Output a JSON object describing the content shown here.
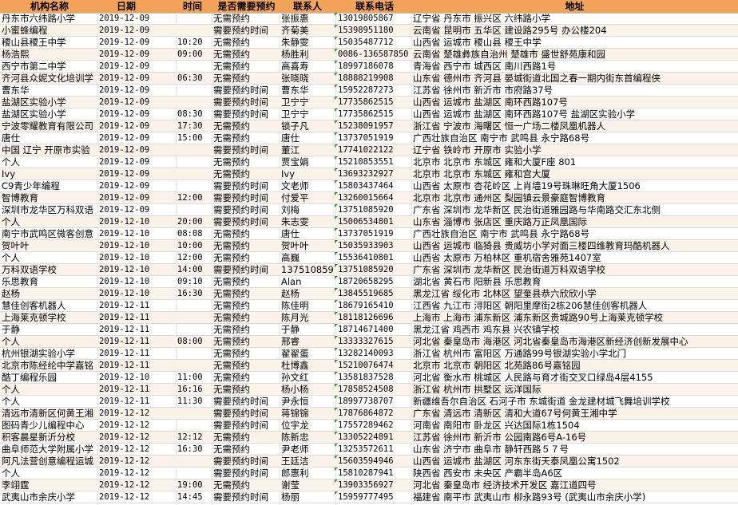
{
  "headers": [
    "机构名称",
    "日期",
    "时间",
    "是否需要预约",
    "联系人",
    "联系电话",
    "地址"
  ],
  "rows": [
    [
      "丹东市六纬路小学",
      "2019-12-09",
      "",
      "无需预约",
      "张振惠",
      "13019805867",
      "辽宁省 丹东市 振兴区 六纬路小学"
    ],
    [
      "小蜜蜂编程",
      "2019-12-09",
      "",
      "需要预约时间",
      "齐菊美",
      "15398951180",
      "云南省 昆明市 五华区 建设路295号 办公楼204"
    ],
    [
      "稷山县稷王中学",
      "2019-12-09",
      "10:20",
      "无需预约",
      "朱静雯",
      "15035487712",
      "山西省 运城市 稷山县 稷王中学"
    ],
    [
      "杨浩熙",
      "2019-12-09",
      "09:00",
      "无需预约",
      "杨胜利",
      "0086-136587850",
      "云南省 楚雄彝族自治州 楚雄市 盛世舒苑康和园"
    ],
    [
      "西宁市第二中学",
      "2019-12-09",
      "",
      "无需预约",
      "高喜寿",
      "18997186078",
      "青海省 西宁市 城西区 南川西路1号"
    ],
    [
      "齐河县众妮文化培训学",
      "2019-12-09",
      "06:30",
      "无需预约",
      "张晓晓",
      "18888219908",
      "山东省 德州市 齐河县 晏城街道北国之春一期内街东首编程侠"
    ],
    [
      "曹东华",
      "2019-12-09",
      "",
      "需要预约时间",
      "曹东华",
      "15952287273",
      "江苏省 徐州市 新沂市 市府路37号"
    ],
    [
      "盐湖区实验小学",
      "2019-12-09",
      "",
      "需要预约时间",
      "卫宁宁",
      "17735862515",
      "山西省 运城市 盐湖区 南环西路107号"
    ],
    [
      "盐湖区实验小学",
      "2019-12-09",
      "08:30",
      "需要预约时间",
      "卫宁宁",
      "17735862515",
      "山西省 运城市 盐湖区 南环西路107号 盐湖区实验小学"
    ],
    [
      "宁波零耀教育有限公司",
      "2019-12-09",
      "17:30",
      "无需预约",
      "锁子凡",
      "15238091957",
      "浙江省 宁波市 海曙区 恒一广场二楼凤凰机器人"
    ],
    [
      "唐仕",
      "2019-12-09",
      "15:00",
      "无需预约",
      "唐仕",
      "13737051919",
      "广西壮族自治区 南宁市 武鸣县 永宁路68号"
    ],
    [
      "中国 辽宁 开原市实验",
      "2019-12-09",
      "",
      "需要预约时间",
      "董江",
      "17741022122",
      "辽宁省 铁岭市 开原市 实验小学"
    ],
    [
      "个人",
      "2019-12-09",
      "",
      "无需预约",
      "贾宝娟",
      "15210853551",
      "北京市 北京市 东城区 雍和大厦F座 801"
    ],
    [
      "Ivy",
      "2019-12-09",
      "",
      "无需预约",
      "Ivy",
      "13693232927",
      "北京市 北京市 东城区 雍和宫大厦"
    ],
    [
      "C9青少年编程",
      "2019-12-09",
      "",
      "需要预约时间",
      "文老师",
      "15803437464",
      "山西省 太原市 杏花岭区 上肖墙19号珠琳旺角大厦1506"
    ],
    [
      "智博教育",
      "2019-12-09",
      "12:00",
      "需要预约时间",
      "付爱平",
      "13260015664",
      "北京市 北京市 通州区 梨园镇云景豪庭智博教育"
    ],
    [
      "深圳市龙华区万科双语",
      "2019-12-09",
      "",
      "需要预约时间",
      "刘梅",
      "13751085920",
      "广东省 深圳市 龙华新区 民治街道雅园路与华南路交汇东北侧"
    ],
    [
      "个人",
      "2019-12-10",
      "20:00",
      "需要预约时间",
      "朱志雯",
      "15006534801",
      "山东省 淄博市 张店区 重庆路万正凤凰国际"
    ],
    [
      "南宁市武鸣区微客创意",
      "2019-12-10",
      "08:08",
      "无需预约",
      "唐仕",
      "13737051919",
      "广西壮族自治区 南宁市 武鸣县 永宁路68号"
    ],
    [
      "贺叶叶",
      "2019-12-10",
      "10:00",
      "无需预约",
      "贺叶叶",
      "15035933903",
      "山西省 运城市 临猗县 贵威坊小学对面三楼四维教育玛酷机器人"
    ],
    [
      "个人",
      "2019-12-10",
      "12:00",
      "无需预约",
      "高巍",
      "15536410801",
      "山西省 太原市 万柏林区 重机宿舍雅苑1407室"
    ],
    [
      "万科双语学校",
      "2019-12-10",
      "14:00",
      "需要预约时间",
      "13751085920",
      "13751085920",
      "广东省 深圳市 龙华新区 民治街道万科双语学校"
    ],
    [
      "乐思教育",
      "2019-12-10",
      "09:10",
      "无需预约",
      "Alan",
      "18720658295",
      "湖北省 黄石市 阳新县 乐思教育"
    ],
    [
      "赵杨",
      "2019-12-10",
      "16:30",
      "无需预约",
      "赵杨",
      "13845519685",
      "黑龙江省 绥化市 北林区 望奎县恭六欣欣小学"
    ],
    [
      "慧佳创客机器人",
      "2019-12-11",
      "",
      "无需预约",
      "陈佳明",
      "18679165410",
      "江西省 九江市 浔阳区 朝阳里摩街2栋206慧佳创客机器人"
    ],
    [
      "上海莱克顿学校",
      "2019-12-11",
      "",
      "无需预约",
      "陈月光",
      "18118126696",
      "上海市 上海市 浦东新区 浦东新区贵城路90号上海莱克顿学校"
    ],
    [
      "于静",
      "2019-12-11",
      "",
      "无需预约",
      "于静",
      "18714671400",
      "黑龙江省 鸡西市 鸡东县 兴农镇学校"
    ],
    [
      "个人",
      "2019-12-11",
      "08:00",
      "无需预约",
      "邢睿",
      "13333327615",
      "河北省 秦皇岛市 海港区 河北省秦皇岛市海港区新经济创新发展中心"
    ],
    [
      "杭州银湖实验小学",
      "2019-12-11",
      "",
      "无需预约",
      "翟翟蛋",
      "13282140093",
      "浙江省 杭州市 富阳区 万通路99号银湖实验小学北门"
    ],
    [
      "北京市陈经纶中学嘉铭",
      "2019-12-11",
      "",
      "无需预约",
      "杜博鑫",
      "15210076474",
      "北京市 北京市 朝阳区 北苑路86号嘉铭园"
    ],
    [
      "酷丁编程乐园",
      "2019-12-10",
      "11:00",
      "无需预约",
      "孙文红",
      "13581837528",
      "河北省 衡水市 桃城区 人民路与育才街交叉口绿岛4层4155"
    ],
    [
      "个人",
      "2019-12-11",
      "16:16",
      "无需预约",
      "杨小杨",
      "17858524508",
      "浙江省 杭州市 拱墅区 远洋国际"
    ],
    [
      "个人",
      "2019-12-11",
      "11:30",
      "需要预约时间",
      "尹永恒",
      "18997738707",
      "新疆维吾尔自治区 石河子市 东城街道 金龙建材城飞舞培训学校"
    ],
    [
      "清远市清新区何黄王湘",
      "2019-12-12",
      "",
      "需要预约时间",
      "蒋锦锦",
      "17876864872",
      "广东省 清远市 清新区 清和大道67号何黄王湘中学"
    ],
    [
      "图码青少儿编程中心",
      "2019-12-12",
      "",
      "需要预约时间",
      "位宇龙",
      "17557289462",
      "河南省 南阳市 卧龙区 兴达国际1栋1504"
    ],
    [
      "积客晨星新沂分校",
      "2019-12-12",
      "12:12",
      "无需预约",
      "陈新忠",
      "13305224891",
      "江苏省 徐州市 新沂市 公园南路6号A-16号"
    ],
    [
      "曲阜师范大学附属小学",
      "2019-12-12",
      "16:30",
      "无需预约",
      "尹老师",
      "13253572611",
      "山东省 济宁市 曲阜市 静轩西路５７号"
    ],
    [
      "阿凡法营创意编程运城",
      "2019-12-12",
      "",
      "需要预约时间",
      "王廷洁",
      "15603594946",
      "山西省 运城市 盐湖区 河东东街天泰凤凰公寓1502"
    ],
    [
      "个人",
      "2019-12-12",
      "",
      "需要预约时间",
      "郎惠利",
      "15810287941",
      "陕西省 西安市 未央区 产霸半岛A6区"
    ],
    [
      "李翊霆",
      "2019-12-12",
      "19:00",
      "无需预约",
      "谢莹",
      "13903356927",
      "河北省 秦皇岛市 经济技术开发区 嘉江道四号"
    ],
    [
      "武夷山市余庆小学",
      "2019-12-12",
      "14:45",
      "需要预约时间",
      "杨丽",
      "15959777495",
      "福建省 南平市 武夷山市 柳永路93号 (武夷山市余庆小学)"
    ]
  ]
}
